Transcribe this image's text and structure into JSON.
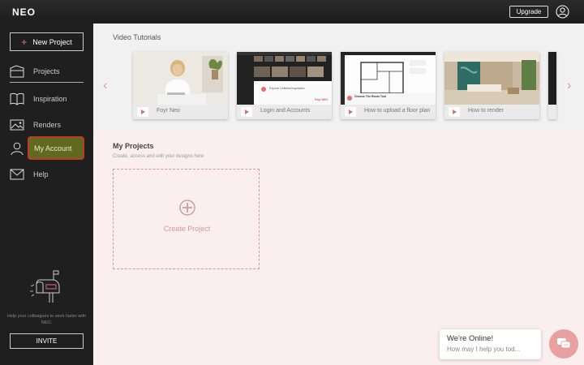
{
  "app": {
    "logo": "NEO"
  },
  "topbar": {
    "upgrade_label": "Upgrade"
  },
  "sidebar": {
    "new_project_label": "New Project",
    "items": [
      {
        "label": "Projects",
        "icon": "projects-icon"
      },
      {
        "label": "Inspiration",
        "icon": "book-icon"
      },
      {
        "label": "Renders",
        "icon": "image-icon"
      },
      {
        "label": "My Account",
        "icon": "user-icon"
      },
      {
        "label": "Help",
        "icon": "mail-icon"
      }
    ],
    "invite_text": "Help your colleagues to work faster with NEO.",
    "invite_label": "INVITE"
  },
  "tutorials": {
    "title": "Video Tutorials",
    "cards": [
      {
        "caption": "Foyr Neo"
      },
      {
        "caption": "Login and Accounts",
        "thumb_heading": "Explore Limitless Inspiration",
        "thumb_logo": "Foyr NEO"
      },
      {
        "caption": "How to upload a floor plan",
        "thumb_heading": "Choose The Room Tool"
      },
      {
        "caption": "How to render"
      }
    ]
  },
  "projects": {
    "title": "My Projects",
    "subtitle": "Create, access and edit your designs here",
    "create_label": "Create Project"
  },
  "chat": {
    "title": "We're Online!",
    "subtitle": "How may I help you tod..."
  },
  "colors": {
    "accent": "#e07070",
    "sidebar_bg": "#1f1f1f",
    "highlight": "#5f6a1f"
  }
}
